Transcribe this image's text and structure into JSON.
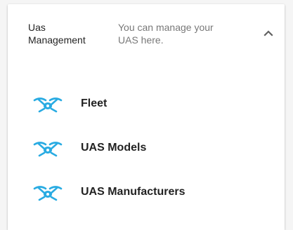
{
  "section": {
    "title": "Uas Management",
    "title_line1": "Uas",
    "title_line2": "Management",
    "description": "You can manage your UAS here.",
    "description_line1": "You can manage your",
    "description_line2": "UAS here.",
    "expanded": true,
    "toggle_icon": "chevron-up-icon"
  },
  "menu": {
    "items": [
      {
        "label": "Fleet",
        "icon": "drone-icon"
      },
      {
        "label": "UAS Models",
        "icon": "drone-icon"
      },
      {
        "label": "UAS Manufacturers",
        "icon": "drone-icon"
      }
    ]
  },
  "colors": {
    "icon": "#29abe2",
    "text_primary": "#212121",
    "text_secondary": "#757575"
  }
}
